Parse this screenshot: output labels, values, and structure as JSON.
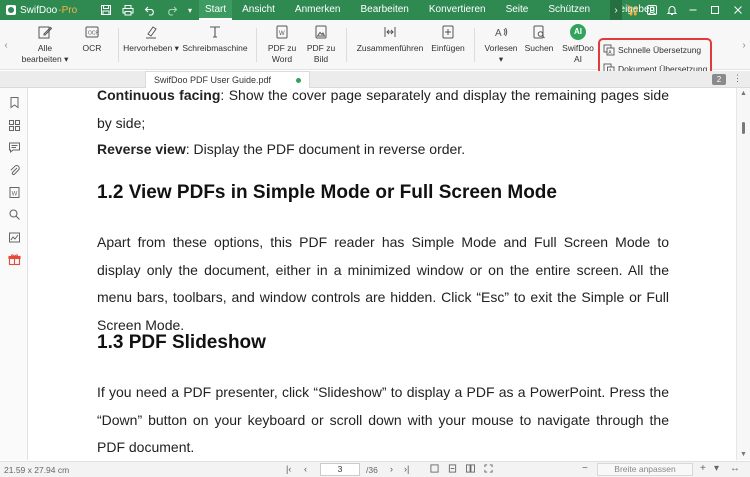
{
  "app": {
    "name": "SwifDoo",
    "edition": "-Pro"
  },
  "menu": [
    "Start",
    "Ansicht",
    "Anmerken",
    "Bearbeiten",
    "Konvertieren",
    "Seite",
    "Schützen",
    "Freigeben"
  ],
  "ribbon": {
    "alle_bearbeiten": "Alle",
    "alle_bearbeiten_2": "bearbeiten",
    "ocr": "OCR",
    "hervorheben": "Hervorheben",
    "schreibmaschine": "Schreibmaschine",
    "pdf_zu_word_1": "PDF zu",
    "pdf_zu_word_2": "Word",
    "pdf_zu_bild_1": "PDF zu",
    "pdf_zu_bild_2": "Bild",
    "zusammenfuehren": "Zusammenführen",
    "einfuegen": "Einfügen",
    "vorlesen": "Vorlesen",
    "suchen": "Suchen",
    "ai_1": "SwifDoo",
    "ai_2": "AI",
    "ai_badge": "AI",
    "schnelle_uebersetzung": "Schnelle Übersetzung",
    "dokument_uebersetzung": "Dokument Übersetzung"
  },
  "tab": {
    "filename": "SwifDoo PDF User Guide.pdf",
    "count": "2"
  },
  "document": {
    "p1_bold": "Continuous facing",
    "p1_text": ": Show the cover page separately and display the remaining pages side by side;",
    "p2_bold": "Reverse view",
    "p2_text": ": Display the PDF document in reverse order.",
    "h1": "1.2 View PDFs in Simple Mode or Full Screen Mode",
    "p3": "Apart from these options, this PDF reader has Simple Mode and Full Screen Mode to display only the document, either in a minimized window or on the entire screen. All the menu bars, toolbars, and window controls are hidden. Click “Esc” to exit the Simple or Full Screen Mode.",
    "h2": "1.3 PDF Slideshow",
    "p4": "If you need a PDF presenter, click “Slideshow” to display a PDF as a PowerPoint. Press the “Down” button on your keyboard or scroll down with your mouse to navigate through the PDF document."
  },
  "status": {
    "page_size": "21.59 x 27.94 cm",
    "current_page": "3",
    "total_pages": "/36",
    "fit_mode": "Breite anpassen"
  },
  "colors": {
    "brand": "#2f8a52",
    "highlight_box": "#e53939",
    "accent": "#31a35b"
  }
}
